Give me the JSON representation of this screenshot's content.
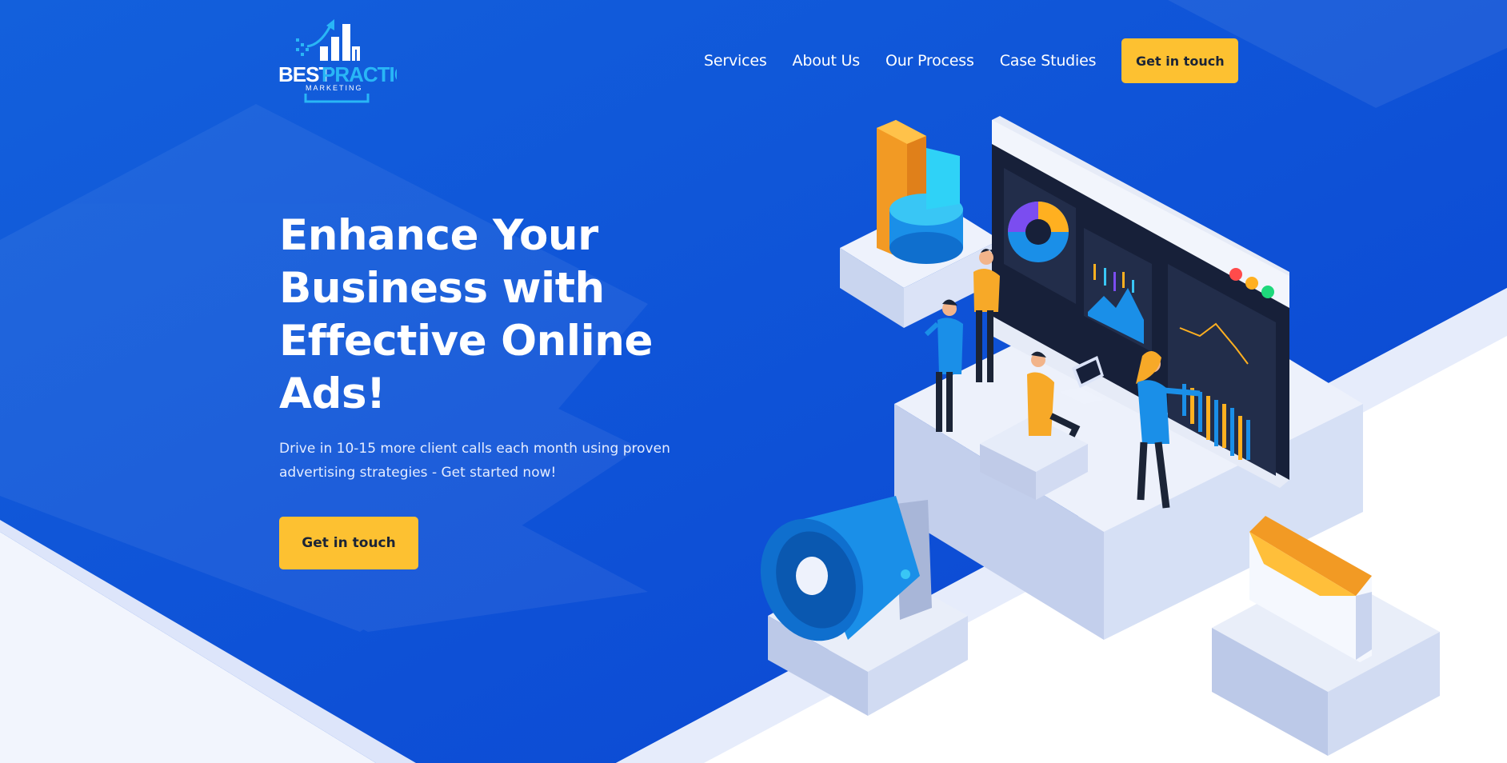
{
  "brand": {
    "logo_word1": "BEST",
    "logo_word2": "PRACTICE",
    "logo_tag": "MARKETING"
  },
  "nav": {
    "items": [
      {
        "label": "Services"
      },
      {
        "label": "About Us"
      },
      {
        "label": "Our Process"
      },
      {
        "label": "Case Studies"
      }
    ],
    "cta_label": "Get in touch"
  },
  "hero": {
    "title": "Enhance Your Business with Effective Online Ads!",
    "subtitle": "Drive in 10-15 more client calls each month using proven advertising strategies - Get started now!",
    "cta_label": "Get in touch"
  },
  "colors": {
    "primary_blue": "#0f56d9",
    "accent_yellow": "#fdc131",
    "text_dark": "#1b2436",
    "logo_light_blue": "#29b6f6"
  }
}
